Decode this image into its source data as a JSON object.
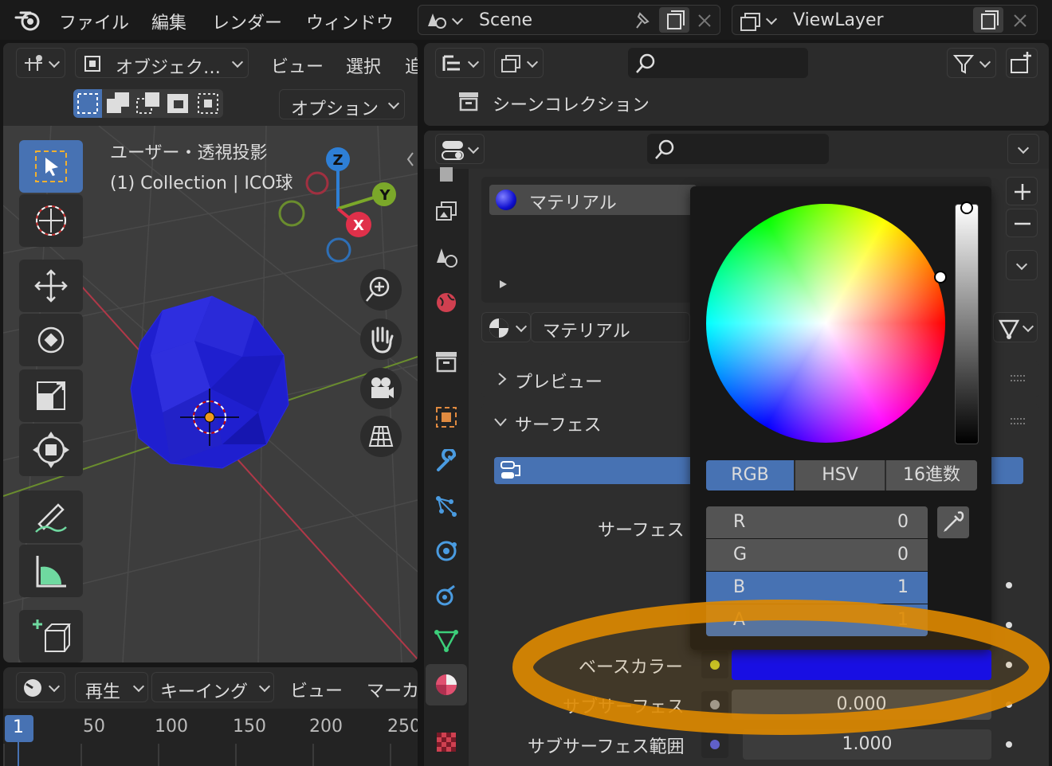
{
  "topbar": {
    "menus": [
      "ファイル",
      "編集",
      "レンダー",
      "ウィンドウ"
    ],
    "scene_name": "Scene",
    "viewlayer_name": "ViewLayer"
  },
  "viewport_header": {
    "mode_label": "オブジェク…",
    "menus": [
      "ビュー",
      "選択",
      "追"
    ],
    "options_label": "オプション"
  },
  "viewport": {
    "view_title": "ユーザー・透視投影",
    "object_info": "(1) Collection | ICO球",
    "axis_labels": {
      "z": "Z",
      "y": "Y",
      "x": "X"
    }
  },
  "outliner": {
    "scene_collection": "シーンコレクション"
  },
  "properties": {
    "material_slot": "マテリアル",
    "material_name": "マテリアル",
    "preview_label": "プレビュー",
    "surface_label": "サーフェス",
    "surface_field_label": "サーフェス",
    "base_color_label": "ベースカラー",
    "base_color_hex": "#0000ff",
    "subsurface_label": "サブサーフェス",
    "subsurface_value": "0.000",
    "subsurface_radius_label": "サブサーフェス範囲",
    "subsurface_radius_value": "1.000"
  },
  "color_picker": {
    "tabs": [
      "RGB",
      "HSV",
      "16進数"
    ],
    "active_tab": "RGB",
    "channels": [
      {
        "label": "R",
        "value": "0"
      },
      {
        "label": "G",
        "value": "0"
      },
      {
        "label": "B",
        "value": "1"
      },
      {
        "label": "A",
        "value": "1"
      }
    ],
    "brightness_value": 1.0
  },
  "timeline": {
    "menus": [
      "再生",
      "キーイング",
      "ビュー",
      "マーカ"
    ],
    "current_frame": "1",
    "ticks": [
      "50",
      "100",
      "150",
      "200",
      "250"
    ]
  },
  "annotation": {
    "highlight_color": "#e08a00"
  }
}
